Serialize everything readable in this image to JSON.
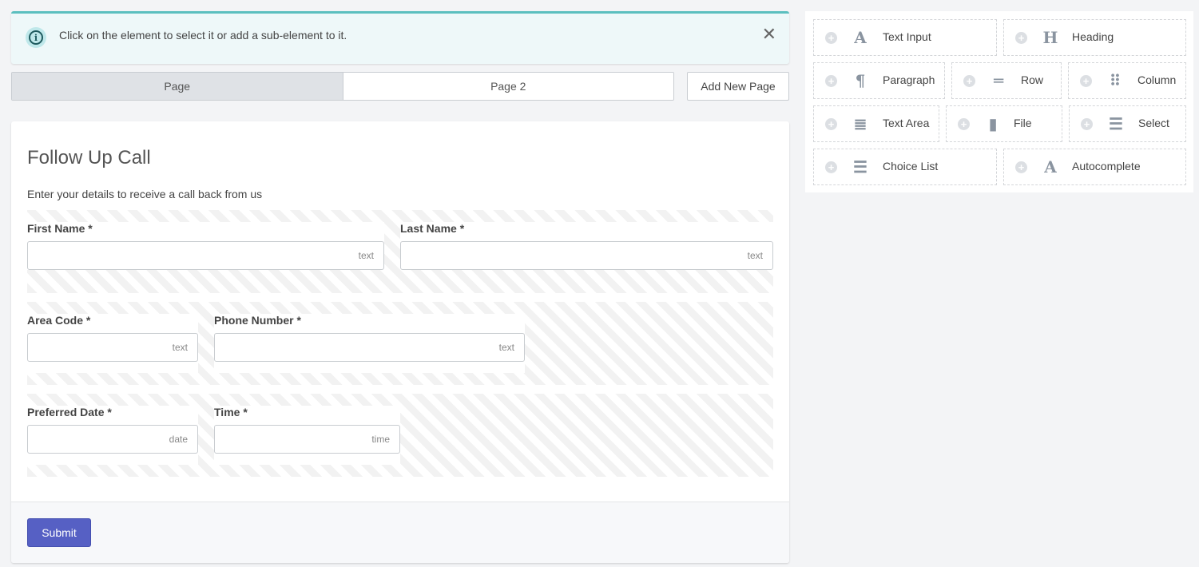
{
  "alert": {
    "message": "Click on the element to select it or add a sub-element to it.",
    "close_glyph": "✕",
    "info_glyph": "i"
  },
  "pages": {
    "tabs": [
      {
        "label": "Page",
        "active": true
      },
      {
        "label": "Page 2",
        "active": false
      }
    ],
    "add_label": "Add New Page"
  },
  "form": {
    "title": "Follow Up Call",
    "description": "Enter your details to receive a call back from us",
    "fields": [
      {
        "label": "First Name *",
        "type": "text"
      },
      {
        "label": "Last Name *",
        "type": "text"
      },
      {
        "label": "Area Code *",
        "type": "text"
      },
      {
        "label": "Phone Number *",
        "type": "text"
      },
      {
        "label": "Preferred Date *",
        "type": "date"
      },
      {
        "label": "Time *",
        "type": "time"
      }
    ],
    "submit_label": "Submit"
  },
  "palette": {
    "plus_glyph": "+",
    "items": [
      {
        "label": "Text Input",
        "icon": "A"
      },
      {
        "label": "Heading",
        "icon": "H"
      },
      {
        "label": "Paragraph",
        "icon": "¶"
      },
      {
        "label": "Row",
        "icon": "═"
      },
      {
        "label": "Column",
        "icon": "⠿"
      },
      {
        "label": "Text Area",
        "icon": "≣"
      },
      {
        "label": "File",
        "icon": "▮"
      },
      {
        "label": "Select",
        "icon": "☰"
      },
      {
        "label": "Choice List",
        "icon": "☰"
      },
      {
        "label": "Autocomplete",
        "icon": "A"
      }
    ]
  }
}
